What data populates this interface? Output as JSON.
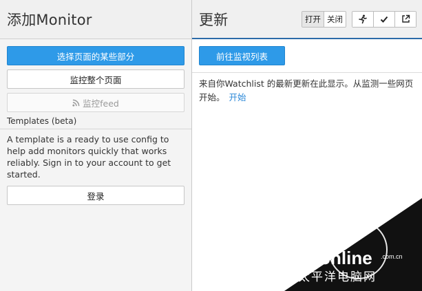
{
  "left": {
    "title": "添加Monitor",
    "select_parts_button": "选择页面的某些部分",
    "monitor_page_button": "监控整个页面",
    "monitor_feed_button": "监控feed",
    "templates_label": "Templates (beta)",
    "templates_desc": "A template is a ready to use config to help add monitors quickly that works reliably. Sign in to your account to get started.",
    "login_button": "登录"
  },
  "right": {
    "title": "更新",
    "toggle_on": "打开",
    "toggle_off": "关闭",
    "goto_button": "前往监视列表",
    "message": "来自你Watchlist 的最新更新在此显示。从监测一些网页开始。",
    "start_link": "开始"
  },
  "watermark": {
    "brand": "PConline",
    "domain": ".com.cn",
    "cn": "太平洋电脑网"
  },
  "colors": {
    "primary": "#2e9ae8",
    "link": "#2b88d8"
  }
}
